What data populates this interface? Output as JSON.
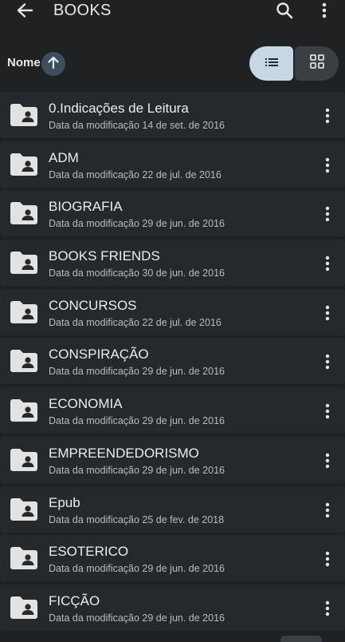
{
  "appbar": {
    "title": "BOOKS",
    "back_icon": "arrow-back-icon",
    "search_icon": "search-icon",
    "more_icon": "more-vert-icon"
  },
  "sort": {
    "label": "Nome",
    "direction": "ascending",
    "view_mode": "list"
  },
  "colors": {
    "background": "#1f2123",
    "row": "#26292c",
    "accent": "#c7d7e6"
  },
  "folders": [
    {
      "name": "0.Indicações de Leitura",
      "modified": "Data da modificação 14 de set. de 2016"
    },
    {
      "name": "ADM",
      "modified": "Data da modificação 22 de jul. de 2016"
    },
    {
      "name": "BIOGRAFIA",
      "modified": "Data da modificação 29 de jun. de 2016"
    },
    {
      "name": "BOOKS FRIENDS",
      "modified": "Data da modificação 30 de jun. de 2016"
    },
    {
      "name": "CONCURSOS",
      "modified": "Data da modificação 22 de jul. de 2016"
    },
    {
      "name": "CONSPIRAÇÃO",
      "modified": "Data da modificação 29 de jun. de 2016"
    },
    {
      "name": "ECONOMIA",
      "modified": "Data da modificação 29 de jun. de 2016"
    },
    {
      "name": "EMPREENDEDORISMO",
      "modified": "Data da modificação 29 de jun. de 2016"
    },
    {
      "name": "Epub",
      "modified": "Data da modificação 25 de fev. de 2018"
    },
    {
      "name": "ESOTERICO",
      "modified": "Data da modificação 29 de jun. de 2016"
    },
    {
      "name": "FICÇÃO",
      "modified": "Data da modificação 29 de jun. de 2016"
    }
  ]
}
